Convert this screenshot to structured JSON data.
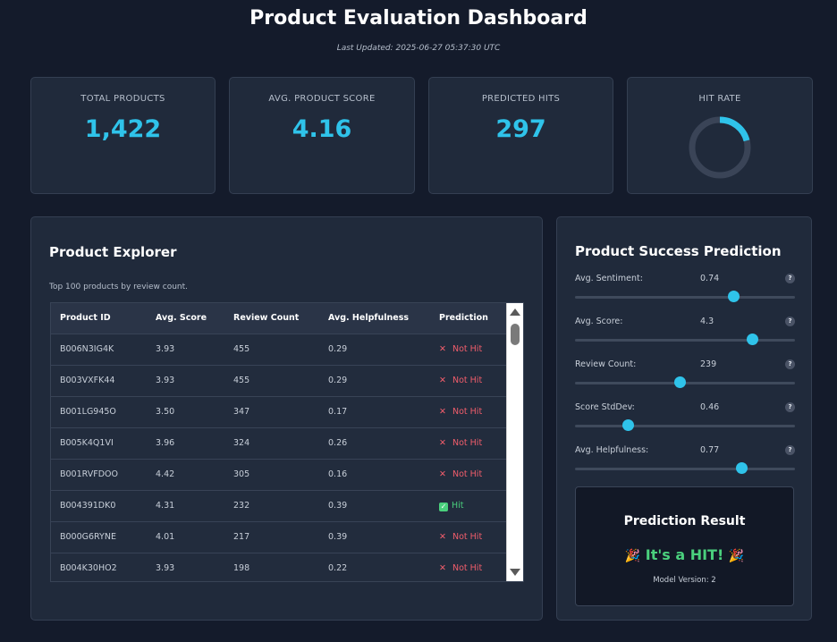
{
  "header": {
    "title": "Product Evaluation Dashboard",
    "last_updated": "Last Updated: 2025-06-27 05:37:30 UTC"
  },
  "stats": [
    {
      "label": "Total Products",
      "value": "1,422"
    },
    {
      "label": "Avg. Product Score",
      "value": "4.16"
    },
    {
      "label": "Predicted Hits",
      "value": "297"
    },
    {
      "label": "Hit Rate",
      "fraction": 0.209
    }
  ],
  "explorer": {
    "title": "Product Explorer",
    "description": "Top 100 products by review count.",
    "columns": [
      "Product ID",
      "Avg. Score",
      "Review Count",
      "Avg. Helpfulness",
      "Prediction"
    ],
    "rows": [
      {
        "id": "B006N3IG4K",
        "score": "3.93",
        "reviews": "455",
        "helpfulness": "0.29",
        "prediction": "Not Hit",
        "hit": false
      },
      {
        "id": "B003VXFK44",
        "score": "3.93",
        "reviews": "455",
        "helpfulness": "0.29",
        "prediction": "Not Hit",
        "hit": false
      },
      {
        "id": "B001LG945O",
        "score": "3.50",
        "reviews": "347",
        "helpfulness": "0.17",
        "prediction": "Not Hit",
        "hit": false
      },
      {
        "id": "B005K4Q1VI",
        "score": "3.96",
        "reviews": "324",
        "helpfulness": "0.26",
        "prediction": "Not Hit",
        "hit": false
      },
      {
        "id": "B001RVFDOO",
        "score": "4.42",
        "reviews": "305",
        "helpfulness": "0.16",
        "prediction": "Not Hit",
        "hit": false
      },
      {
        "id": "B004391DK0",
        "score": "4.31",
        "reviews": "232",
        "helpfulness": "0.39",
        "prediction": "Hit",
        "hit": true
      },
      {
        "id": "B000G6RYNE",
        "score": "4.01",
        "reviews": "217",
        "helpfulness": "0.39",
        "prediction": "Not Hit",
        "hit": false
      },
      {
        "id": "B004K30HO2",
        "score": "3.93",
        "reviews": "198",
        "helpfulness": "0.22",
        "prediction": "Not Hit",
        "hit": false
      }
    ]
  },
  "prediction": {
    "title": "Product Success Prediction",
    "sliders": [
      {
        "label": "Avg. Sentiment:",
        "value": "0.74",
        "level": 0.72
      },
      {
        "label": "Avg. Score:",
        "value": "4.3",
        "level": 0.805
      },
      {
        "label": "Review Count:",
        "value": "239",
        "level": 0.475
      },
      {
        "label": "Score StdDev:",
        "value": "0.46",
        "level": 0.24
      },
      {
        "label": "Avg. Helpfulness:",
        "value": "0.77",
        "level": 0.755
      }
    ],
    "help_glyph": "?",
    "result_title": "Prediction Result",
    "result_text": "It's a HIT!",
    "model_version": "Model Version: 2"
  },
  "colors": {
    "accent": "#2fc3ea",
    "hit": "#4ad07d",
    "miss": "#f05d6b",
    "background": "#141b2b",
    "card": "#202a3b"
  },
  "icons": {
    "not_hit": "cross-icon",
    "hit": "check-box-icon",
    "result": "party-popper-icon"
  }
}
